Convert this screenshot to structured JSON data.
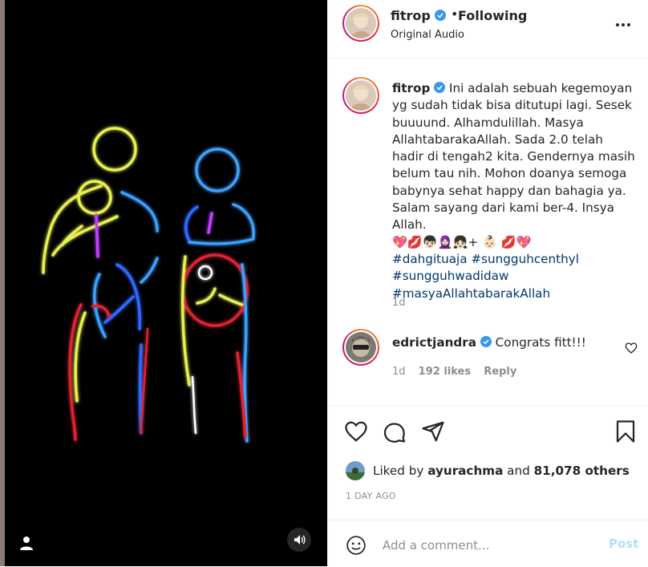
{
  "post": {
    "username": "fitrop",
    "follow_status": "Following",
    "separator": "•",
    "audio_label": "Original Audio"
  },
  "caption": {
    "username": "fitrop",
    "text": "Ini adalah sebuah kegemoyan yg sudah tidak bisa ditutupi lagi. Sesek buuuund. Alhamdulillah. Masya AllahtabarakaAllah. Sada 2.0 telah hadir di tengah2 kita. Gendernya masih belum tau nih. Mohon doanya semoga babynya sehat happy dan bahagia ya. Salam sayang dari kami ber-4. Insya Allah.",
    "emojis": "💖💋👦🏻🧕🏻👧🏻+ 👶🏻 💋💖",
    "hashtags": [
      "#dahgituaja #sungguhcenthyl",
      "#sungguhwadidaw",
      "#masyaAllahtabarakAllah"
    ],
    "time": "1d"
  },
  "comment": {
    "username": "edrictjandra",
    "text": "Congrats fitt!!!",
    "time": "1d",
    "likes": "192 likes",
    "reply_label": "Reply"
  },
  "likes": {
    "prefix": "Liked by",
    "user": "ayurachma",
    "conjunction": "and",
    "others": "81,078 others"
  },
  "timestamp": "1 DAY AGO",
  "add_comment": {
    "placeholder": "Add a comment...",
    "post_label": "Post"
  },
  "icons": [
    "more-icon",
    "verified-icon",
    "heart-icon",
    "comment-icon",
    "share-icon",
    "save-icon",
    "smile-icon",
    "mute-icon",
    "user-tag-icon"
  ]
}
